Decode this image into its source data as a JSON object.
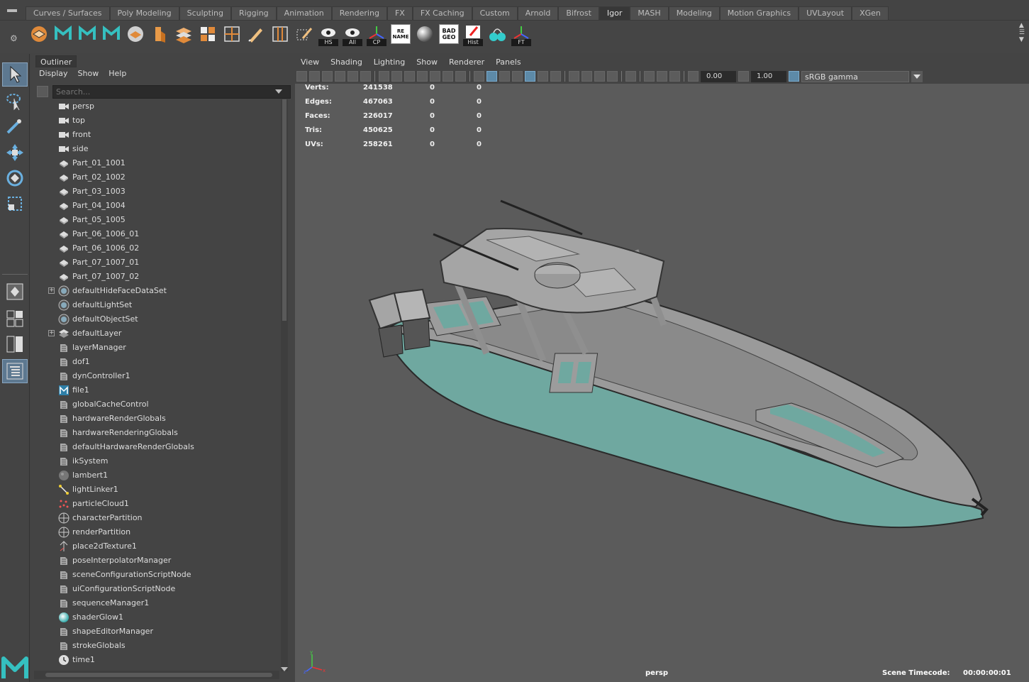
{
  "shelf": {
    "tabs": [
      "Curves / Surfaces",
      "Poly Modeling",
      "Sculpting",
      "Rigging",
      "Animation",
      "Rendering",
      "FX",
      "FX Caching",
      "Custom",
      "Arnold",
      "Bifrost",
      "Igor",
      "MASH",
      "Modeling",
      "Motion Graphics",
      "UVLayout",
      "XGen"
    ],
    "active_tab": "Igor",
    "icon_labels": {
      "hs": "HS",
      "all": "All",
      "cp": "CP",
      "rename": "RE NAME",
      "badgeo": "BAD GEO",
      "hist": "Hist",
      "ft": "FT"
    }
  },
  "outliner": {
    "tab_label": "Outliner",
    "menu": [
      "Display",
      "Show",
      "Help"
    ],
    "search_placeholder": "Search...",
    "items": [
      {
        "label": "persp",
        "icon": "camera-icon"
      },
      {
        "label": "top",
        "icon": "camera-icon"
      },
      {
        "label": "front",
        "icon": "camera-icon"
      },
      {
        "label": "side",
        "icon": "camera-icon"
      },
      {
        "label": "Part_01_1001",
        "icon": "mesh-icon"
      },
      {
        "label": "Part_02_1002",
        "icon": "mesh-icon"
      },
      {
        "label": "Part_03_1003",
        "icon": "mesh-icon"
      },
      {
        "label": "Part_04_1004",
        "icon": "mesh-icon"
      },
      {
        "label": "Part_05_1005",
        "icon": "mesh-icon"
      },
      {
        "label": "Part_06_1006_01",
        "icon": "mesh-icon"
      },
      {
        "label": "Part_06_1006_02",
        "icon": "mesh-icon"
      },
      {
        "label": "Part_07_1007_01",
        "icon": "mesh-icon"
      },
      {
        "label": "Part_07_1007_02",
        "icon": "mesh-icon"
      },
      {
        "label": "defaultHideFaceDataSet",
        "icon": "set-icon",
        "expandable": true
      },
      {
        "label": "defaultLightSet",
        "icon": "set-icon"
      },
      {
        "label": "defaultObjectSet",
        "icon": "set-icon"
      },
      {
        "label": "defaultLayer",
        "icon": "layer-icon",
        "expandable": true
      },
      {
        "label": "layerManager",
        "icon": "node-icon"
      },
      {
        "label": "dof1",
        "icon": "node-icon"
      },
      {
        "label": "dynController1",
        "icon": "node-icon"
      },
      {
        "label": "file1",
        "icon": "file-texture-icon"
      },
      {
        "label": "globalCacheControl",
        "icon": "node-icon"
      },
      {
        "label": "hardwareRenderGlobals",
        "icon": "node-icon"
      },
      {
        "label": "hardwareRenderingGlobals",
        "icon": "node-icon"
      },
      {
        "label": "defaultHardwareRenderGlobals",
        "icon": "node-icon"
      },
      {
        "label": "ikSystem",
        "icon": "node-icon"
      },
      {
        "label": "lambert1",
        "icon": "material-sphere-icon"
      },
      {
        "label": "lightLinker1",
        "icon": "light-linker-icon"
      },
      {
        "label": "particleCloud1",
        "icon": "particle-icon"
      },
      {
        "label": "characterPartition",
        "icon": "partition-icon"
      },
      {
        "label": "renderPartition",
        "icon": "partition-icon"
      },
      {
        "label": "place2dTexture1",
        "icon": "place2d-icon"
      },
      {
        "label": "poseInterpolatorManager",
        "icon": "node-icon"
      },
      {
        "label": "sceneConfigurationScriptNode",
        "icon": "node-icon"
      },
      {
        "label": "uiConfigurationScriptNode",
        "icon": "node-icon"
      },
      {
        "label": "sequenceManager1",
        "icon": "node-icon"
      },
      {
        "label": "shaderGlow1",
        "icon": "glow-icon"
      },
      {
        "label": "shapeEditorManager",
        "icon": "node-icon"
      },
      {
        "label": "strokeGlobals",
        "icon": "node-icon"
      },
      {
        "label": "time1",
        "icon": "clock-icon"
      }
    ]
  },
  "viewport": {
    "menu": [
      "View",
      "Shading",
      "Lighting",
      "Show",
      "Renderer",
      "Panels"
    ],
    "exposure": "0.00",
    "gamma": "1.00",
    "color_space": "sRGB gamma",
    "hud": [
      {
        "label": "Verts:",
        "values": [
          "241538",
          "0",
          "0"
        ]
      },
      {
        "label": "Edges:",
        "values": [
          "467063",
          "0",
          "0"
        ]
      },
      {
        "label": "Faces:",
        "values": [
          "226017",
          "0",
          "0"
        ]
      },
      {
        "label": "Tris:",
        "values": [
          "450625",
          "0",
          "0"
        ]
      },
      {
        "label": "UVs:",
        "values": [
          "258261",
          "0",
          "0"
        ]
      }
    ],
    "camera_name": "persp",
    "timecode_label": "Scene Timecode:",
    "timecode_value": "00:00:00:01"
  },
  "colors": {
    "viewport_bg": "#5b5b5b",
    "hull": "#6fa8a0",
    "selection": "#5d7890"
  }
}
